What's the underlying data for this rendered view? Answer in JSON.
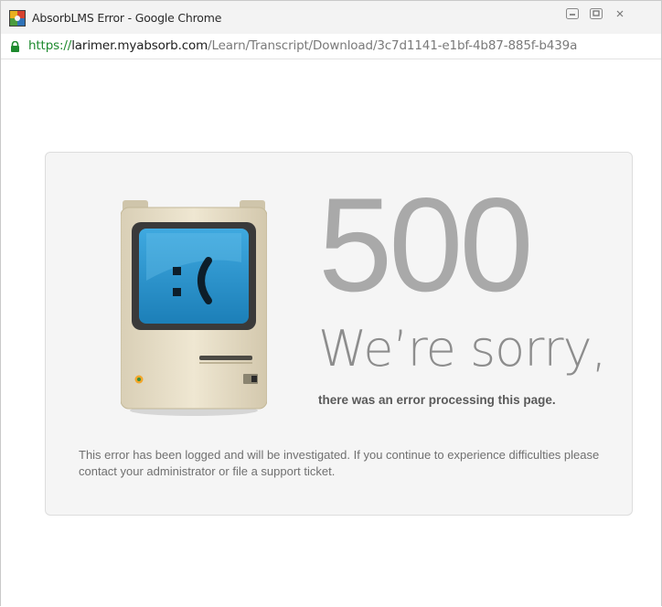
{
  "window": {
    "title": "AbsorbLMS Error - Google Chrome"
  },
  "address_bar": {
    "scheme": "https://",
    "host": "larimer.myabsorb.com",
    "path": "/Learn/Transcript/Download/3c7d1141-e1bf-4b87-885f-b439a"
  },
  "error": {
    "code": "500",
    "headline": "We’re sorry,",
    "subheadline": "there was an error processing this page.",
    "note": "This error has been logged and will be investigated. If you continue to experience difficulties please contact your administrator or file a support ticket.",
    "screen_face": ":("
  },
  "icons": {
    "app": "absorb-app-icon",
    "lock": "lock-icon",
    "minimize": "minimize-icon",
    "maximize": "maximize-icon",
    "close": "close-icon",
    "illustration": "sad-mac-computer-icon"
  },
  "colors": {
    "url_scheme": "#1e8a2e",
    "error_code": "#a9a9a9",
    "screen": "#2d9ad6"
  }
}
